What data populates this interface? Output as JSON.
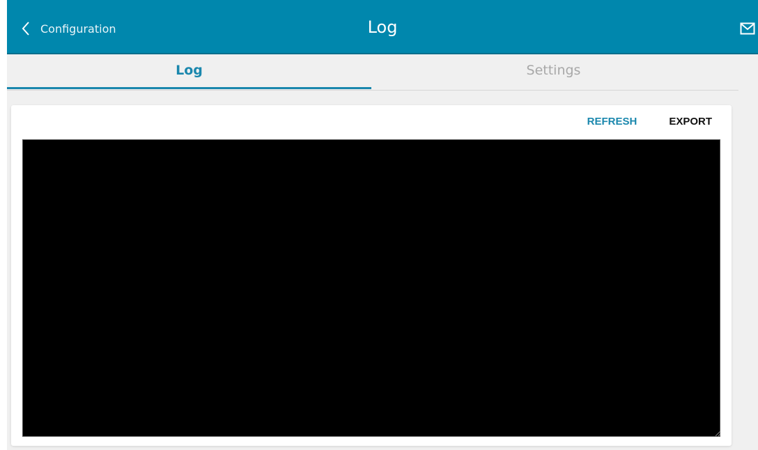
{
  "header": {
    "back_label": "Configuration",
    "title": "Log",
    "icons": {
      "back": "chevron-left-icon",
      "mail": "mail-icon"
    }
  },
  "tabs": [
    {
      "label": "Log",
      "active": true
    },
    {
      "label": "Settings",
      "active": false
    }
  ],
  "actions": {
    "refresh_label": "REFRESH",
    "export_label": "EXPORT"
  },
  "log": {
    "content": ""
  },
  "colors": {
    "header_bg": "#0087ad",
    "accent": "#1a87ad",
    "inactive_tab": "#a8a8a8",
    "page_bg": "#f0f0f0",
    "log_bg": "#000000"
  }
}
